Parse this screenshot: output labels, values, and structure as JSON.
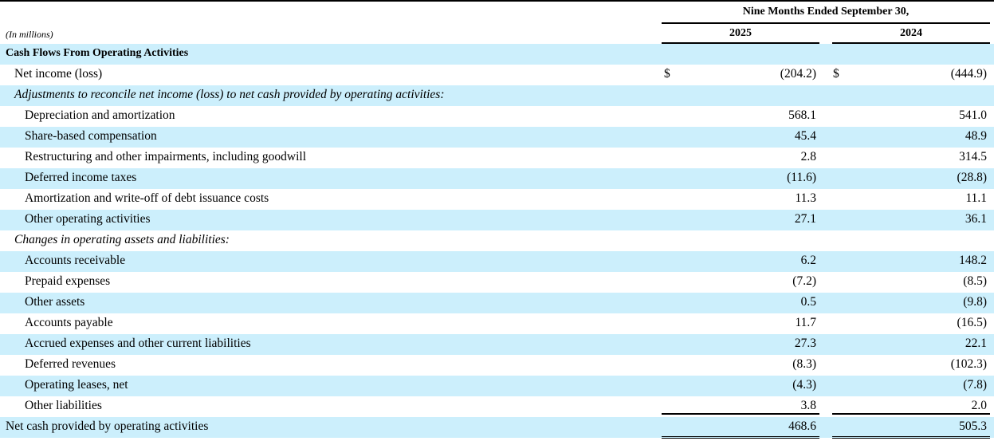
{
  "header": {
    "period": "Nine Months Ended September 30,",
    "units": "(In millions)",
    "year_current": "2025",
    "year_prior": "2024"
  },
  "rows": [
    {
      "label": "Cash Flows From Operating Activities",
      "type": "section",
      "level": 0,
      "shaded": true,
      "v2025": "",
      "v2024": ""
    },
    {
      "label": "Net income (loss)",
      "level": 1,
      "shaded": false,
      "currency": "$",
      "v2025": "(204.2)",
      "v2024": "(444.9)"
    },
    {
      "label": "Adjustments to reconcile net income (loss) to net cash provided by operating activities:",
      "type": "italic",
      "level": 1,
      "shaded": true,
      "v2025": "",
      "v2024": ""
    },
    {
      "label": "Depreciation and amortization",
      "level": 2,
      "shaded": false,
      "v2025": "568.1",
      "v2024": "541.0"
    },
    {
      "label": "Share-based compensation",
      "level": 2,
      "shaded": true,
      "v2025": "45.4",
      "v2024": "48.9"
    },
    {
      "label": "Restructuring and other impairments, including goodwill",
      "level": 2,
      "shaded": false,
      "v2025": "2.8",
      "v2024": "314.5"
    },
    {
      "label": "Deferred income taxes",
      "level": 2,
      "shaded": true,
      "v2025": "(11.6)",
      "v2024": "(28.8)"
    },
    {
      "label": "Amortization and write-off of debt issuance costs",
      "level": 2,
      "shaded": false,
      "v2025": "11.3",
      "v2024": "11.1"
    },
    {
      "label": "Other operating activities",
      "level": 2,
      "shaded": true,
      "v2025": "27.1",
      "v2024": "36.1"
    },
    {
      "label": "Changes in operating assets and liabilities:",
      "type": "italic",
      "level": 1,
      "shaded": false,
      "v2025": "",
      "v2024": ""
    },
    {
      "label": "Accounts receivable",
      "level": 2,
      "shaded": true,
      "v2025": "6.2",
      "v2024": "148.2"
    },
    {
      "label": "Prepaid expenses",
      "level": 2,
      "shaded": false,
      "v2025": "(7.2)",
      "v2024": "(8.5)"
    },
    {
      "label": "Other assets",
      "level": 2,
      "shaded": true,
      "v2025": "0.5",
      "v2024": "(9.8)"
    },
    {
      "label": "Accounts payable",
      "level": 2,
      "shaded": false,
      "v2025": "11.7",
      "v2024": "(16.5)"
    },
    {
      "label": "Accrued expenses and other current liabilities",
      "level": 2,
      "shaded": true,
      "v2025": "27.3",
      "v2024": "22.1"
    },
    {
      "label": "Deferred revenues",
      "level": 2,
      "shaded": false,
      "v2025": "(8.3)",
      "v2024": "(102.3)"
    },
    {
      "label": "Operating leases, net",
      "level": 2,
      "shaded": true,
      "v2025": "(4.3)",
      "v2024": "(7.8)"
    },
    {
      "label": "Other liabilities",
      "level": 2,
      "shaded": false,
      "v2025": "3.8",
      "v2024": "2.0"
    },
    {
      "label": "Net cash provided by operating activities",
      "type": "total",
      "level": 0,
      "shaded": true,
      "v2025": "468.6",
      "v2024": "505.3"
    }
  ],
  "colors": {
    "shade": "#cceffc",
    "text": "#000000",
    "rule": "#000000"
  }
}
